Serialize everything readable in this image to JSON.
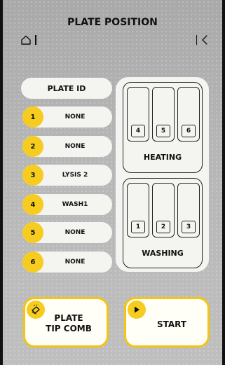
{
  "header": {
    "title": "PLATE POSITION",
    "home_icon": "home-icon",
    "back_icon": "chevron-left-icon"
  },
  "plate_id": {
    "label": "PLATE ID"
  },
  "rows": [
    {
      "number": "1",
      "label": "NONE"
    },
    {
      "number": "2",
      "label": "NONE"
    },
    {
      "number": "3",
      "label": "LYSIS 2"
    },
    {
      "number": "4",
      "label": "WASH1"
    },
    {
      "number": "5",
      "label": "NONE"
    },
    {
      "number": "6",
      "label": "NONE"
    }
  ],
  "heating": {
    "label": "HEATING",
    "slots": [
      "4",
      "5",
      "6"
    ]
  },
  "washing": {
    "label": "WASHING",
    "slots": [
      "1",
      "2",
      "3"
    ]
  },
  "buttons": {
    "plate_tip_comb": {
      "line1": "PLATE",
      "line2": "TIP COMB",
      "icon": "plate-comb-icon"
    },
    "start": {
      "label": "START",
      "icon": "play-icon"
    }
  },
  "colors": {
    "accent": "#f5cc1f",
    "background": "#b3b3b3",
    "surface": "#f4f4f0"
  }
}
